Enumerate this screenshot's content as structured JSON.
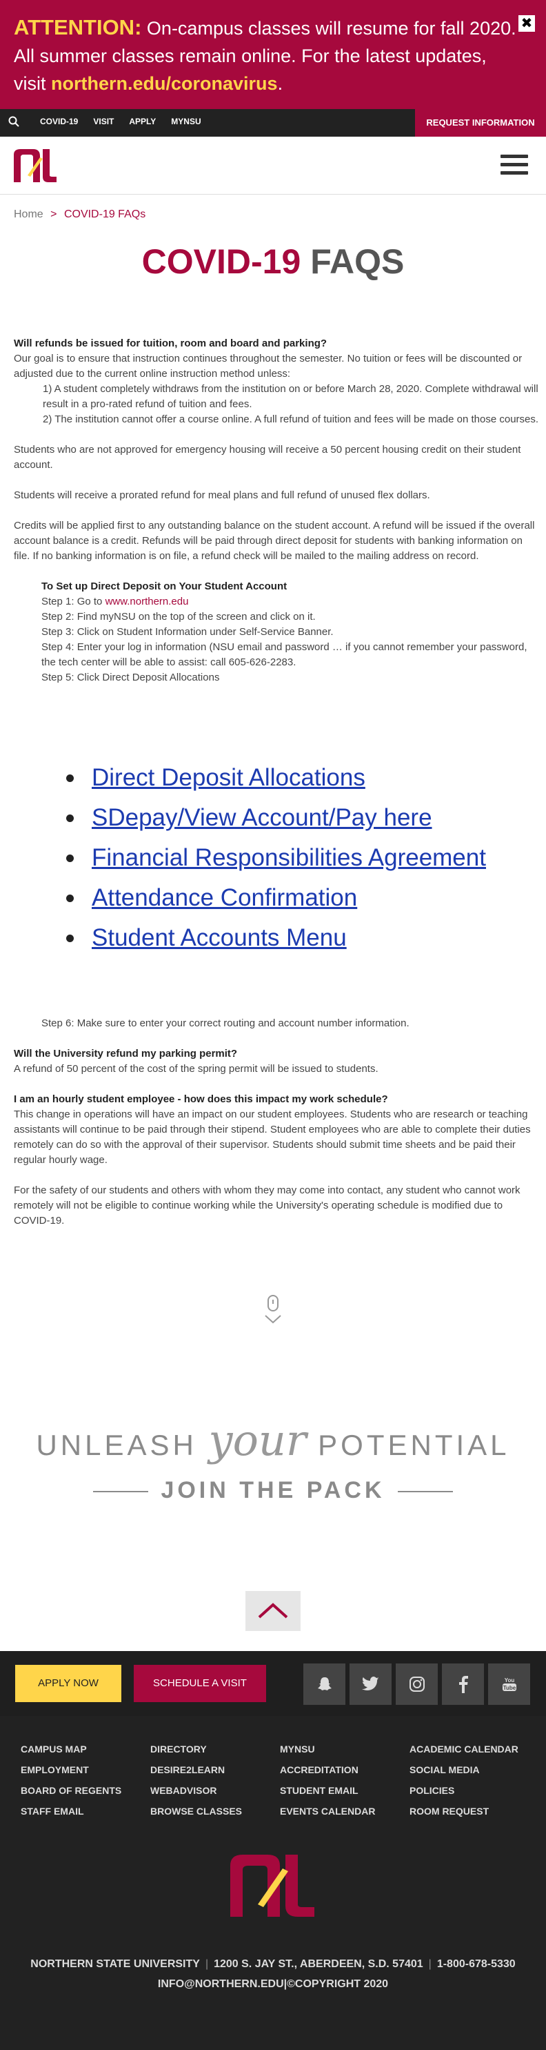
{
  "alert": {
    "label": "ATTENTION:",
    "message": "On-campus classes will resume for fall 2020. All summer classes remain online. For the latest updates, visit",
    "link": "northern.edu/coronavirus",
    "period": ".",
    "close": "✖"
  },
  "utility": {
    "nav": [
      "COVID-19",
      "VISIT",
      "APPLY",
      "myNSU"
    ],
    "request": "REQUEST INFORMATION"
  },
  "breadcrumb": {
    "home": "Home",
    "sep": ">",
    "current": "COVID-19 FAQs"
  },
  "title": {
    "part1": "COVID-19",
    "part2": "FAQS"
  },
  "faq1": {
    "question": "Will refunds be issued for tuition, room and board and parking?",
    "intro": "Our goal is to ensure that instruction continues throughout the semester. No tuition or fees will be discounted or adjusted due to the current online instruction method unless:",
    "cond1": "1) A student completely withdraws from the institution on or before March 28, 2020. Complete withdrawal will result in a pro-rated refund of tuition and fees.",
    "cond2": "2) The institution cannot offer a course online. A full refund of tuition and fees will be made on those courses.",
    "p2": "Students who are not approved for emergency housing will receive a 50 percent housing credit on their student account.",
    "p3": "Students will receive a prorated refund for meal plans and full refund of unused flex dollars.",
    "p4": "Credits will be applied first to any outstanding balance on the student account. A refund will be issued if the overall account balance is a credit. Refunds will be paid through direct deposit for students with banking information on file. If no banking information is on file, a refund check will be mailed to the mailing address on record."
  },
  "deposit": {
    "title": "To Set up Direct Deposit on Your Student Account",
    "step1": "Step 1:  Go to ",
    "step1_link": "www.northern.edu",
    "step2": "Step 2:  Find myNSU on the top of the screen and click on it.",
    "step3": "Step 3:  Click on Student Information under Self-Service Banner.",
    "step4": "Step 4:  Enter your log in information (NSU email and password … if you cannot remember your password, the tech center will be able to assist: call 605-626-2283.",
    "step5": "Step 5:  Click Direct Deposit Allocations",
    "links": [
      "Direct Deposit Allocations",
      "SDepay/View Account/Pay here",
      "Financial Responsibilities Agreement",
      "Attendance Confirmation",
      "Student Accounts Menu"
    ],
    "step6": "Step 6:  Make sure to enter your correct routing and account number information."
  },
  "faq2": {
    "question": "Will the University refund my parking permit?",
    "answer": "A refund of 50 percent of the cost of the spring permit will be issued to students."
  },
  "faq3": {
    "question": "I am an hourly student employee - how does this impact my work schedule?",
    "answer": "This change in operations will have an impact on our student employees. Students who are research or teaching assistants will continue to be paid through their stipend. Student employees who are able to complete their duties remotely can do so with the approval of their supervisor. Students should submit time sheets and be paid their regular hourly wage.",
    "answer2": "For the safety of our students and others with whom they may come into contact, any student who cannot work remotely will not be eligible to continue working while the University's operating schedule is modified due to COVID-19."
  },
  "tagline": {
    "unleash": "UNLEASH",
    "your": "your",
    "potential": "POTENTIAL",
    "join": "JOIN THE PACK"
  },
  "footer": {
    "apply": "APPLY NOW",
    "visit": "SCHEDULE A VISIT",
    "social": [
      "snapchat-icon",
      "twitter-icon",
      "instagram-icon",
      "facebook-icon",
      "youtube-icon"
    ],
    "links": [
      "CAMPUS MAP",
      "DIRECTORY",
      "MYNSU",
      "ACADEMIC CALENDAR",
      "EMPLOYMENT",
      "DESIRE2LEARN",
      "ACCREDITATION",
      "SOCIAL MEDIA",
      "BOARD OF REGENTS",
      "WEBADVISOR",
      "STUDENT EMAIL",
      "POLICIES",
      "STAFF EMAIL",
      "BROWSE CLASSES",
      "EVENTS CALENDAR",
      "ROOM REQUEST"
    ],
    "university": "NORTHERN STATE UNIVERSITY",
    "address": "1200 S. JAY ST., ABERDEEN, S.D. 57401",
    "phone": "1-800-678-5330",
    "email": "INFO@NORTHERN.EDU",
    "copyright": "©COPYRIGHT 2020"
  },
  "colors": {
    "maroon": "#a6093d",
    "gold": "#ffd54a",
    "dark": "#222222"
  }
}
